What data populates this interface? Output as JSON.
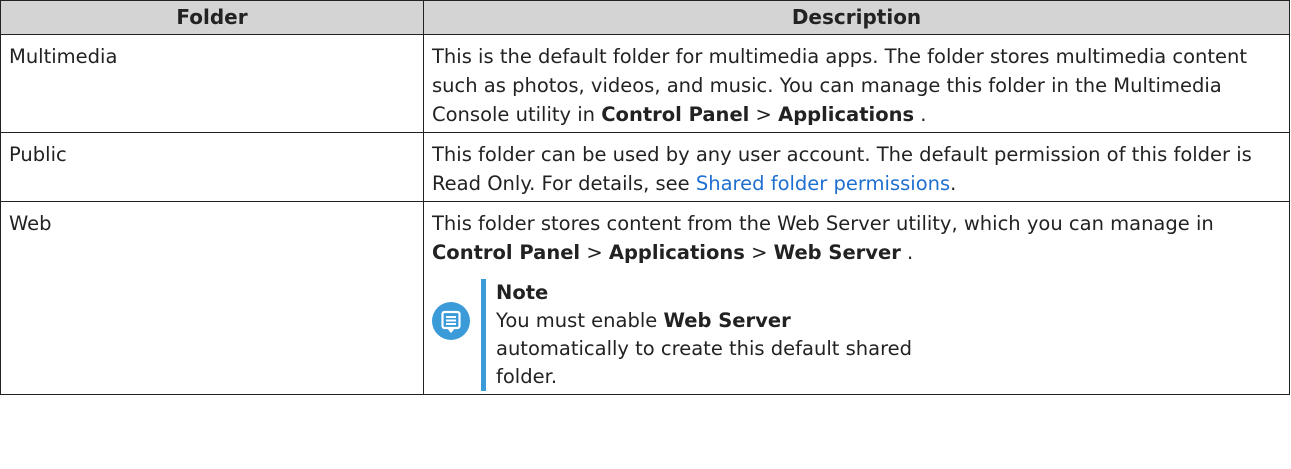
{
  "table": {
    "headers": {
      "folder": "Folder",
      "description": "Description"
    },
    "rows": [
      {
        "folder": "Multimedia",
        "desc": {
          "text1": "This is the default folder for multimedia apps. The folder stores multimedia content such as photos, videos, and music. You can manage this folder in the Multimedia Console utility in ",
          "bold1": "Control Panel",
          "sep1": " > ",
          "bold2": "Applications",
          "end": " ."
        }
      },
      {
        "folder": "Public",
        "desc": {
          "text1": "This folder can be used by any user account. The default permission of this folder is Read Only. For details, see ",
          "link": "Shared folder permissions",
          "end": "."
        }
      },
      {
        "folder": "Web",
        "desc": {
          "text1": "This folder stores content from the Web Server utility, which you can manage in ",
          "bold1": "Control Panel",
          "sep1": " > ",
          "bold2": "Applications",
          "sep2": " > ",
          "bold3": "Web Server",
          "end": " ."
        },
        "note": {
          "icon": "note-icon",
          "title": "Note",
          "text1": "You must enable ",
          "bold": "Web Server",
          "text2": " automatically to create this default shared folder."
        }
      }
    ]
  },
  "colors": {
    "header_bg": "#d4d4d4",
    "border": "#222222",
    "link": "#1f6fd0",
    "note_accent": "#3a9bd8"
  }
}
